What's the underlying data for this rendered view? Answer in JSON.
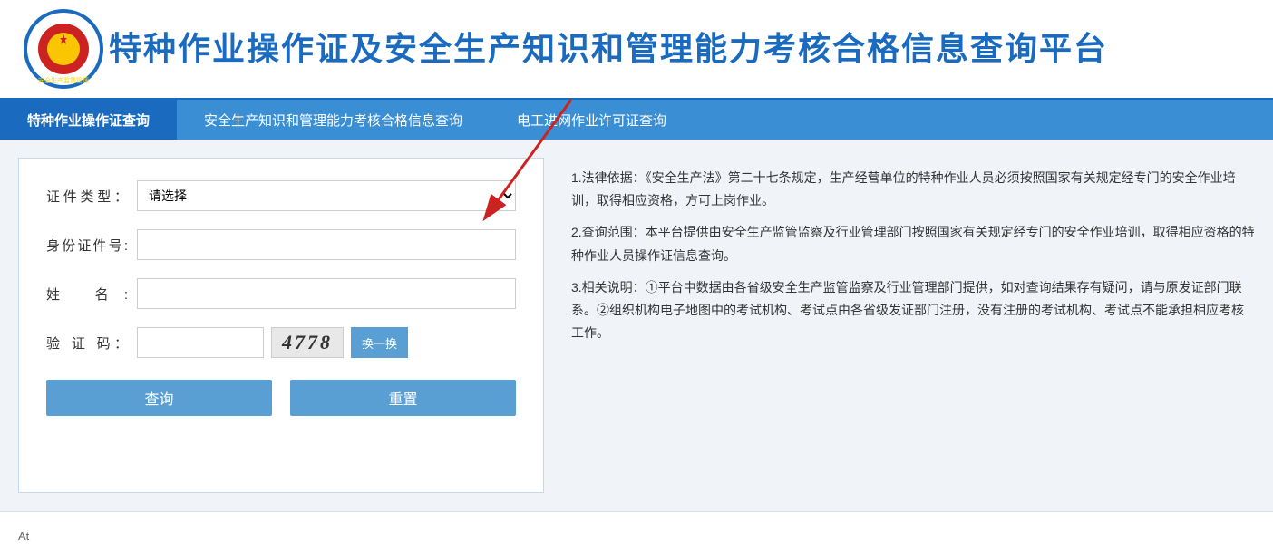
{
  "header": {
    "title": "特种作业操作证及安全生产知识和管理能力考核合格信息查询平台"
  },
  "nav": {
    "tabs": [
      {
        "id": "tab1",
        "label": "特种作业操作证查询",
        "active": true
      },
      {
        "id": "tab2",
        "label": "安全生产知识和管理能力考核合格信息查询",
        "active": false
      },
      {
        "id": "tab3",
        "label": "电工进网作业许可证查询",
        "active": false
      }
    ]
  },
  "form": {
    "cert_type_label": "证件类型：",
    "cert_type_placeholder": "请选择",
    "id_number_label": "身份证件号:",
    "name_label": "姓       名:",
    "captcha_label": "验 证 码：",
    "captcha_value": "4778",
    "captcha_refresh_label": "换一换",
    "query_button": "查询",
    "reset_button": "重置"
  },
  "info": {
    "items": [
      "1.法律依据：《安全生产法》第二十七条规定，生产经营单位的特种作业人员必须按照国家有关规定经专门的安全作业培训，取得相应资格，方可上岗作业。",
      "2.查询范围：本平台提供由安全生产监管监察及行业管理部门按照国家有关规定经专门的安全作业培训，取得相应资格的特种作业人员操作证信息查询。",
      "3.相关说明：①平台中数据由各省级安全生产监管监察及行业管理部门提供，如对查询结果存有疑问，请与原发证部门联系。②组织机构电子地图中的考试机构、考试点由各省级发证部门注册，没有注册的考试机构、考试点不能承担相应考核工作。"
    ]
  },
  "footer": {
    "text": "At"
  },
  "logo": {
    "alt": "安全生产监督管理局 logo"
  }
}
